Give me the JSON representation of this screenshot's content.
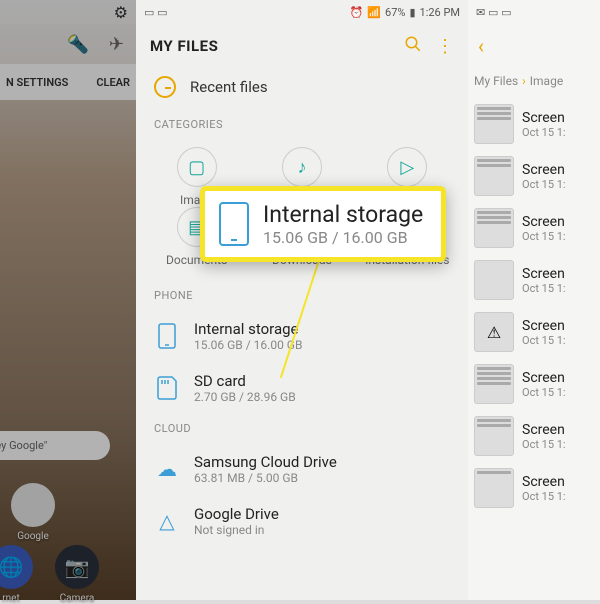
{
  "status": {
    "battery": "67%",
    "time": "1:26 PM"
  },
  "left": {
    "settings": "N SETTINGS",
    "clear": "CLEAR",
    "search_hint": "\"Hey Google\"",
    "apps": {
      "google": "Google",
      "internet": "rnet",
      "camera": "Camera"
    }
  },
  "center": {
    "title": "MY FILES",
    "recent": "Recent files",
    "cat_label": "CATEGORIES",
    "cats": {
      "images": "Image",
      "audio": "Audio",
      "videos": "Video",
      "documents": "Documents",
      "downloads": "Downloads",
      "install": "Installation files"
    },
    "phone_label": "PHONE",
    "internal": {
      "name": "Internal storage",
      "sub": "15.06 GB / 16.00 GB"
    },
    "sd": {
      "name": "SD card",
      "sub": "2.70 GB / 28.96 GB"
    },
    "cloud_label": "CLOUD",
    "samsung": {
      "name": "Samsung Cloud Drive",
      "sub": "63.81 MB / 5.00 GB"
    },
    "gdrive": {
      "name": "Google Drive",
      "sub": "Not signed in"
    }
  },
  "right": {
    "crumb1": "My Files",
    "crumb2": "Image",
    "file_name": "Screen",
    "file_date": "Oct 15 1:"
  },
  "callout": {
    "title": "Internal storage",
    "sub": "15.06 GB / 16.00 GB"
  }
}
